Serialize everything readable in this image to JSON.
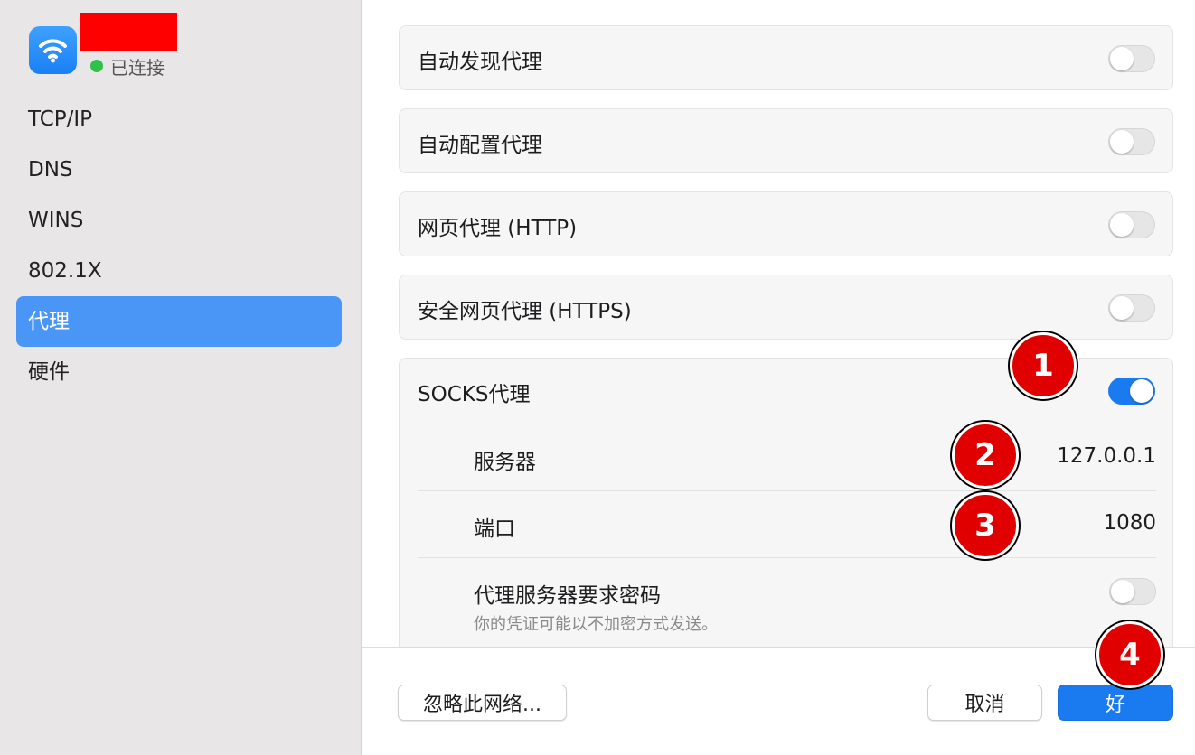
{
  "sidebar": {
    "status": "已连接",
    "status_color": "#2fc24a",
    "items": [
      {
        "label": "TCP/IP"
      },
      {
        "label": "DNS"
      },
      {
        "label": "WINS"
      },
      {
        "label": "802.1X"
      },
      {
        "label": "代理"
      },
      {
        "label": "硬件"
      }
    ],
    "active_index": 4,
    "accent": "#4a96f7"
  },
  "proxies": {
    "auto_discover": {
      "label": "自动发现代理",
      "enabled": false
    },
    "auto_config": {
      "label": "自动配置代理",
      "enabled": false
    },
    "http": {
      "label": "网页代理 (HTTP)",
      "enabled": false
    },
    "https": {
      "label": "安全网页代理 (HTTPS)",
      "enabled": false
    },
    "socks": {
      "label": "SOCKS代理",
      "enabled": true,
      "server_label": "服务器",
      "server_value": "127.0.0.1",
      "port_label": "端口",
      "port_value": "1080",
      "password_label": "代理服务器要求密码",
      "password_note": "你的凭证可能以不加密方式发送。",
      "password_enabled": false
    }
  },
  "footer": {
    "ignore_label": "忽略此网络...",
    "cancel_label": "取消",
    "ok_label": "好"
  },
  "markers": [
    "1",
    "2",
    "3",
    "4"
  ],
  "colors": {
    "toggle_on": "#1a7bf0",
    "marker": "#e00000",
    "redaction": "#ff0000"
  }
}
